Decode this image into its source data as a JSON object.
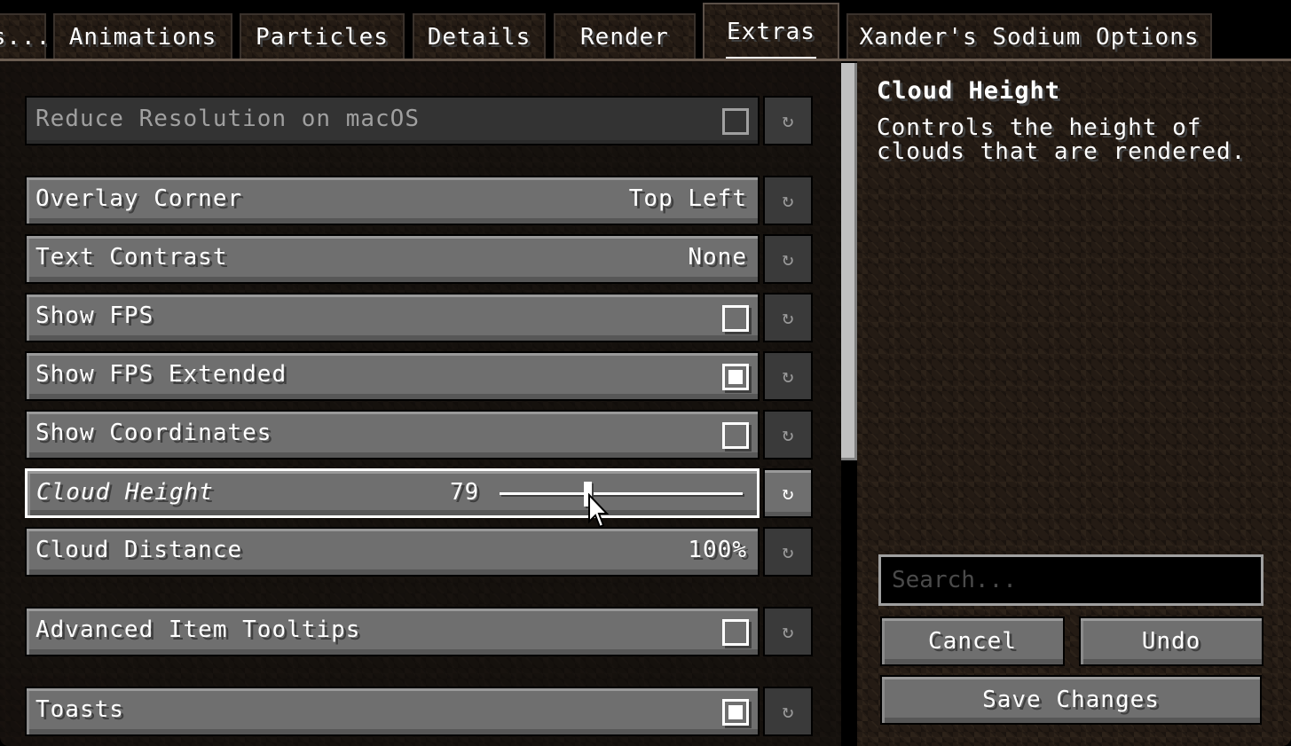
{
  "tabs": [
    {
      "label": "s...",
      "active": false
    },
    {
      "label": "Animations",
      "active": false
    },
    {
      "label": "Particles",
      "active": false
    },
    {
      "label": "Details",
      "active": false
    },
    {
      "label": "Render",
      "active": false
    },
    {
      "label": "Extras",
      "active": true
    },
    {
      "label": "Xander's Sodium Options",
      "active": false
    }
  ],
  "options": [
    {
      "label": "Reduce Resolution on macOS",
      "type": "checkbox",
      "checked": false,
      "disabled": true
    },
    {
      "label": "Overlay Corner",
      "type": "cycle",
      "value": "Top Left"
    },
    {
      "label": "Text Contrast",
      "type": "cycle",
      "value": "None"
    },
    {
      "label": "Show FPS",
      "type": "checkbox",
      "checked": false
    },
    {
      "label": "Show FPS Extended",
      "type": "checkbox",
      "checked": true
    },
    {
      "label": "Show Coordinates",
      "type": "checkbox",
      "checked": false
    },
    {
      "label": "Cloud Height",
      "type": "slider",
      "value": "79",
      "fraction": 0.36,
      "focused": true
    },
    {
      "label": "Cloud Distance",
      "type": "cycle",
      "value": "100%"
    },
    {
      "label": "Advanced Item Tooltips",
      "type": "checkbox",
      "checked": false
    },
    {
      "label": "Toasts",
      "type": "checkbox",
      "checked": true
    }
  ],
  "reset_icon": "reset-arrow-icon",
  "description": {
    "title": "Cloud Height",
    "text": "Controls the height of clouds that are rendered."
  },
  "search": {
    "placeholder": "Search...",
    "value": ""
  },
  "buttons": {
    "cancel": "Cancel",
    "undo": "Undo",
    "save": "Save Changes"
  },
  "scrollbar": {
    "position": 0.0,
    "visible_fraction": 0.58
  }
}
